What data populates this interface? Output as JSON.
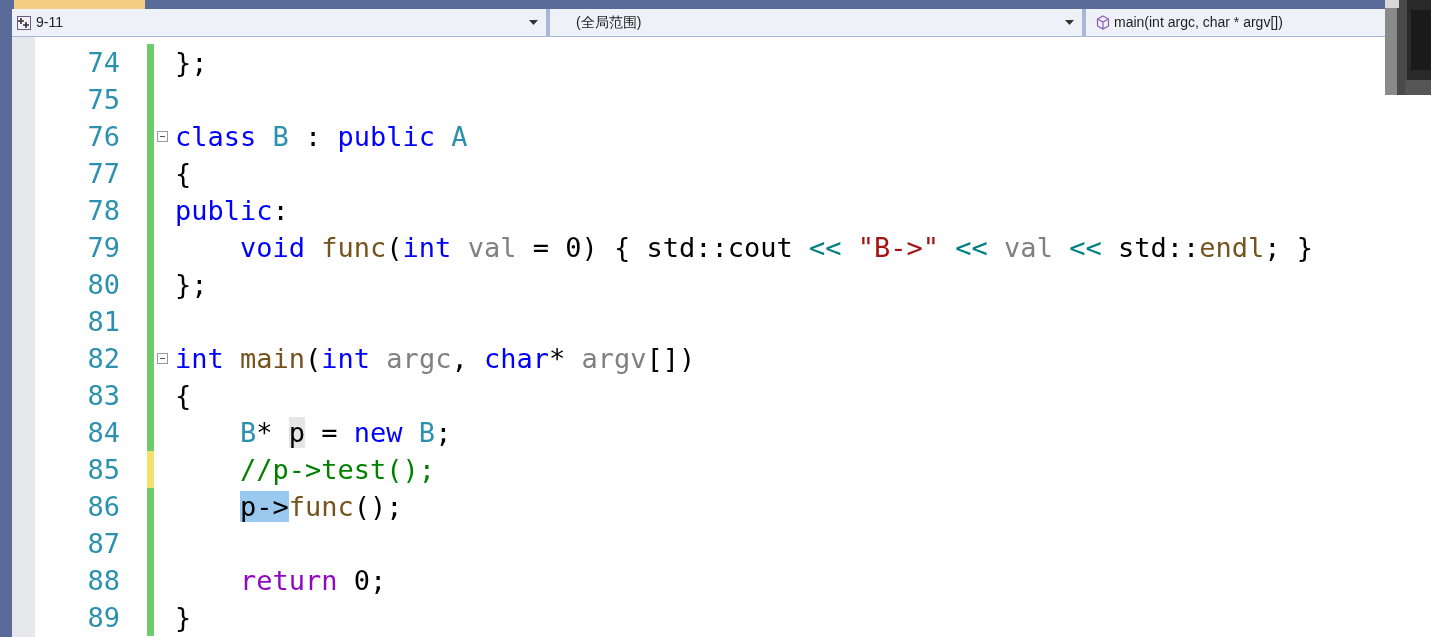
{
  "navigation_bar": {
    "dropdowns": [
      {
        "text": "9-11"
      },
      {
        "text": "(全局范围)"
      },
      {
        "text": "main(int argc, char * argv[])"
      }
    ]
  },
  "editor": {
    "lines": [
      {
        "number": "74",
        "unsaved": false,
        "fold": false,
        "tokens": [
          {
            "text": "};",
            "kind": "plain"
          }
        ]
      },
      {
        "number": "75",
        "unsaved": false,
        "fold": false
      },
      {
        "number": "76",
        "unsaved": false,
        "fold": true,
        "tokens": [
          {
            "text": "class",
            "kind": "keyword"
          },
          {
            "text": " B",
            "kind": "type"
          },
          {
            "text": " :",
            "kind": "plain"
          },
          {
            "text": " public",
            "kind": "keyword"
          },
          {
            "text": " A",
            "kind": "type"
          }
        ]
      },
      {
        "number": "77",
        "unsaved": false,
        "fold": false,
        "tokens": [
          {
            "text": "{",
            "kind": "plain"
          }
        ]
      },
      {
        "number": "78",
        "unsaved": false,
        "fold": false,
        "tokens": [
          {
            "text": "public",
            "kind": "keyword"
          },
          {
            "text": ":",
            "kind": "plain"
          }
        ]
      },
      {
        "number": "79",
        "unsaved": false,
        "fold": false,
        "tokens": [
          {
            "text": "    void",
            "kind": "keyword"
          },
          {
            "text": " func",
            "kind": "function"
          },
          {
            "text": "(",
            "kind": "plain"
          },
          {
            "text": "int",
            "kind": "keyword"
          },
          {
            "text": " val",
            "kind": "parameter"
          },
          {
            "text": " = 0) { std::cout",
            "kind": "plain"
          },
          {
            "text": " <<",
            "kind": "operator"
          },
          {
            "text": " \"B->\"",
            "kind": "string"
          },
          {
            "text": " <<",
            "kind": "operator"
          },
          {
            "text": " val",
            "kind": "parameter"
          },
          {
            "text": " <<",
            "kind": "operator"
          },
          {
            "text": " std::",
            "kind": "plain"
          },
          {
            "text": "endl",
            "kind": "function"
          },
          {
            "text": "; }",
            "kind": "plain"
          }
        ]
      },
      {
        "number": "80",
        "unsaved": false,
        "fold": false,
        "tokens": [
          {
            "text": "};",
            "kind": "plain"
          }
        ]
      },
      {
        "number": "81",
        "unsaved": false,
        "fold": false
      },
      {
        "number": "82",
        "unsaved": false,
        "fold": true,
        "tokens": [
          {
            "text": "int",
            "kind": "keyword"
          },
          {
            "text": " main",
            "kind": "function"
          },
          {
            "text": "(",
            "kind": "plain"
          },
          {
            "text": "int",
            "kind": "keyword"
          },
          {
            "text": " argc",
            "kind": "parameter"
          },
          {
            "text": ",",
            "kind": "plain"
          },
          {
            "text": " char",
            "kind": "keyword"
          },
          {
            "text": "*",
            "kind": "plain"
          },
          {
            "text": " argv",
            "kind": "parameter"
          },
          {
            "text": "[])",
            "kind": "plain"
          }
        ]
      },
      {
        "number": "83",
        "unsaved": false,
        "fold": false,
        "tokens": [
          {
            "text": "{",
            "kind": "plain"
          }
        ]
      },
      {
        "number": "84",
        "unsaved": false,
        "fold": false,
        "tokens": [
          {
            "text": "    B",
            "kind": "type"
          },
          {
            "text": "* ",
            "kind": "plain"
          },
          {
            "text": "p",
            "kind": "plain",
            "referenced": true
          },
          {
            "text": " =",
            "kind": "plain"
          },
          {
            "text": " new",
            "kind": "keyword"
          },
          {
            "text": " B",
            "kind": "type"
          },
          {
            "text": ";",
            "kind": "plain"
          }
        ]
      },
      {
        "number": "85",
        "unsaved": true,
        "fold": false,
        "tokens": [
          {
            "text": "    //p->test();",
            "kind": "comment"
          }
        ]
      },
      {
        "number": "86",
        "unsaved": false,
        "fold": false,
        "indented": true,
        "tokens": [
          {
            "text": "p->",
            "kind": "plain",
            "selected": true
          },
          {
            "text": "func",
            "kind": "function"
          },
          {
            "text": "();",
            "kind": "plain"
          }
        ]
      },
      {
        "number": "87",
        "unsaved": false,
        "fold": false
      },
      {
        "number": "88",
        "unsaved": false,
        "fold": false,
        "tokens": [
          {
            "text": "    return",
            "kind": "control"
          },
          {
            "text": " 0;",
            "kind": "plain"
          }
        ]
      },
      {
        "number": "89",
        "unsaved": false,
        "fold": false,
        "tokens": [
          {
            "text": "}",
            "kind": "plain"
          }
        ]
      }
    ]
  }
}
